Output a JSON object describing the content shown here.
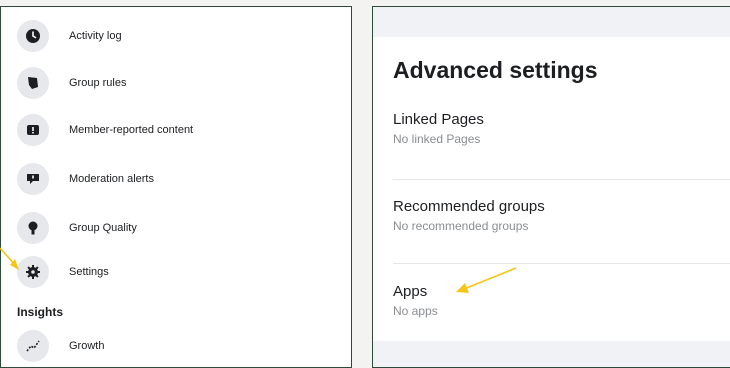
{
  "left_menu": {
    "items": [
      {
        "label": "Activity log",
        "icon": "clock-icon"
      },
      {
        "label": "Group rules",
        "icon": "rules-flag-icon"
      },
      {
        "label": "Member-reported content",
        "icon": "report-icon"
      },
      {
        "label": "Moderation alerts",
        "icon": "alert-icon"
      },
      {
        "label": "Group Quality",
        "icon": "quality-icon"
      },
      {
        "label": "Settings",
        "icon": "gear-icon"
      }
    ],
    "section_heading": "Insights",
    "insights_items": [
      {
        "label": "Growth",
        "icon": "growth-icon"
      }
    ]
  },
  "advanced_settings": {
    "title": "Advanced settings",
    "rows": [
      {
        "title": "Linked Pages",
        "subtitle": "No linked Pages"
      },
      {
        "title": "Recommended groups",
        "subtitle": "No recommended groups"
      },
      {
        "title": "Apps",
        "subtitle": "No apps"
      }
    ]
  },
  "colors": {
    "frame_border": "#2d4a3b",
    "annotation_arrow": "#f5c518",
    "icon_bg": "#e6e8eb",
    "band_bg": "#f0f2f5"
  }
}
